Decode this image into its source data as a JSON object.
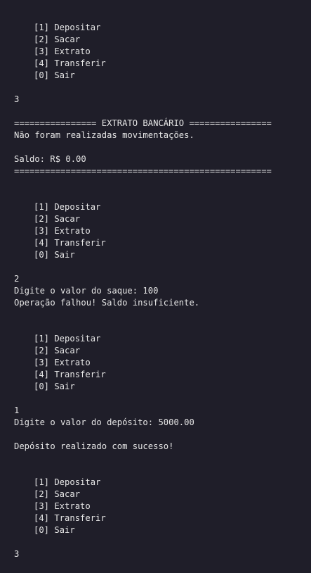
{
  "terminal": {
    "menu1": {
      "items": [
        "[1] Depositar",
        "[2] Sacar",
        "[3] Extrato",
        "[4] Transferir",
        "[0] Sair"
      ]
    },
    "input1": "3",
    "statement": {
      "header": "================ EXTRATO BANCÁRIO ================",
      "no_movements": "Não foram realizadas movimentações.",
      "balance": "Saldo: R$ 0.00",
      "footer": "=================================================="
    },
    "menu2": {
      "items": [
        "[1] Depositar",
        "[2] Sacar",
        "[3] Extrato",
        "[4] Transferir",
        "[0] Sair"
      ]
    },
    "input2": "2",
    "withdraw_prompt": "Digite o valor do saque: 100",
    "withdraw_error": "Operação falhou! Saldo insuficiente.",
    "menu3": {
      "items": [
        "[1] Depositar",
        "[2] Sacar",
        "[3] Extrato",
        "[4] Transferir",
        "[0] Sair"
      ]
    },
    "input3": "1",
    "deposit_prompt": "Digite o valor do depósito: 5000.00",
    "deposit_success": "Depósito realizado com sucesso!",
    "menu4": {
      "items": [
        "[1] Depositar",
        "[2] Sacar",
        "[3] Extrato",
        "[4] Transferir",
        "[0] Sair"
      ]
    },
    "input4": "3"
  }
}
